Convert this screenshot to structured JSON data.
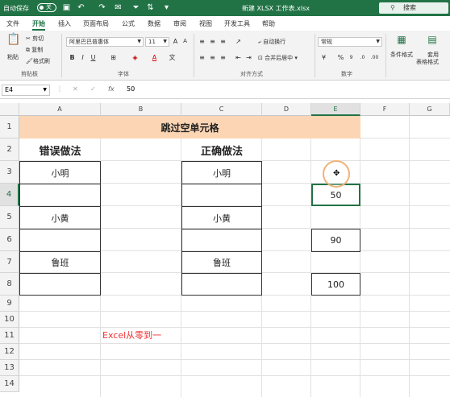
{
  "titlebar": {
    "autosave_label": "自动保存",
    "toggle_state": "关",
    "filename": "新建 XLSX 工作表.xlsx",
    "search_placeholder": "搜索"
  },
  "tabs": [
    "文件",
    "开始",
    "插入",
    "页面布局",
    "公式",
    "数据",
    "审阅",
    "视图",
    "开发工具",
    "帮助"
  ],
  "active_tab": "开始",
  "ribbon": {
    "clipboard": {
      "paste": "粘贴",
      "cut": "剪切",
      "copy": "复制",
      "format_painter": "格式刷",
      "label": "剪贴板"
    },
    "font": {
      "name": "阿里巴巴普惠体",
      "size": "11",
      "label": "字体",
      "bold": "B",
      "italic": "I",
      "underline": "U",
      "font_color_letter": "A"
    },
    "alignment": {
      "wrap": "自动换行",
      "merge": "合并后居中",
      "label": "对齐方式"
    },
    "number": {
      "format": "常规",
      "label": "数字"
    },
    "styles": {
      "conditional": "条件格式",
      "table_format_line1": "套用",
      "table_format_line2": "表格格式"
    }
  },
  "formula_bar": {
    "cell_ref": "E4",
    "value": "50"
  },
  "columns": [
    "A",
    "B",
    "C",
    "D",
    "E",
    "F",
    "G"
  ],
  "rows": [
    "1",
    "2",
    "3",
    "4",
    "5",
    "6",
    "7",
    "8",
    "9",
    "10",
    "11",
    "12",
    "13",
    "14"
  ],
  "sheet": {
    "title": "跳过空单元格",
    "wrong_heading": "错误做法",
    "right_heading": "正确做法",
    "a3": "小明",
    "a5": "小黄",
    "a7": "鲁班",
    "c3": "小明",
    "c5": "小黄",
    "c7": "鲁班",
    "e4": "50",
    "e6": "90",
    "e8": "100",
    "note": "Excel从零到一"
  },
  "colors": {
    "accent": "#217346",
    "title_fill": "#fcd5b4",
    "note": "#e33333"
  }
}
